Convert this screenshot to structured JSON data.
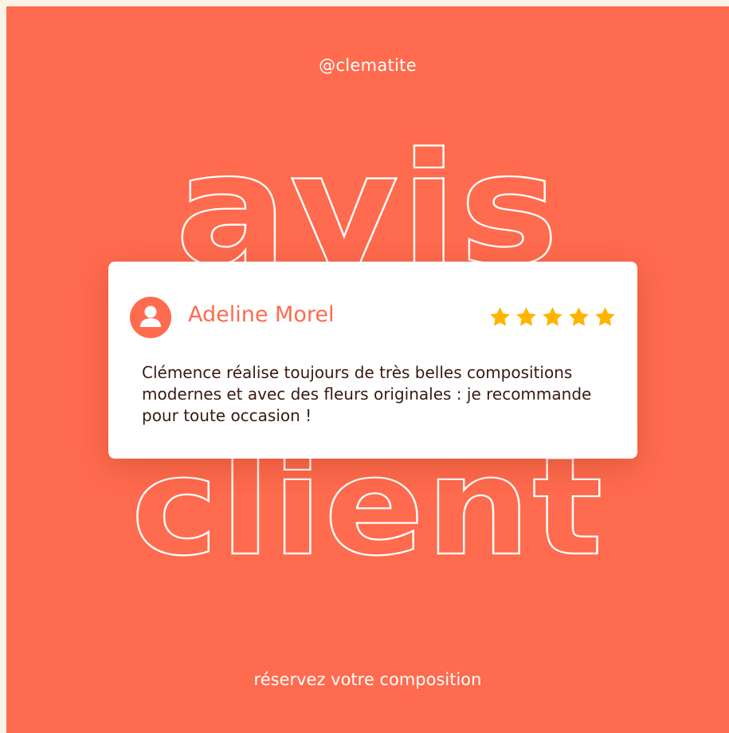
{
  "handle": "@clematite",
  "headline_top": "avis",
  "headline_bottom": "client",
  "review": {
    "name": "Adeline Morel",
    "rating": 5,
    "text": "Clémence réalise toujours de très belles compositions modernes et avec des fleurs originales : je recommande pour toute occasion !"
  },
  "cta": "réservez votre composition",
  "colors": {
    "background": "#ff6b4e",
    "star": "#ffb400",
    "card": "#ffffff"
  },
  "icons": {
    "avatar": "user-icon",
    "rating": "star-icon"
  }
}
